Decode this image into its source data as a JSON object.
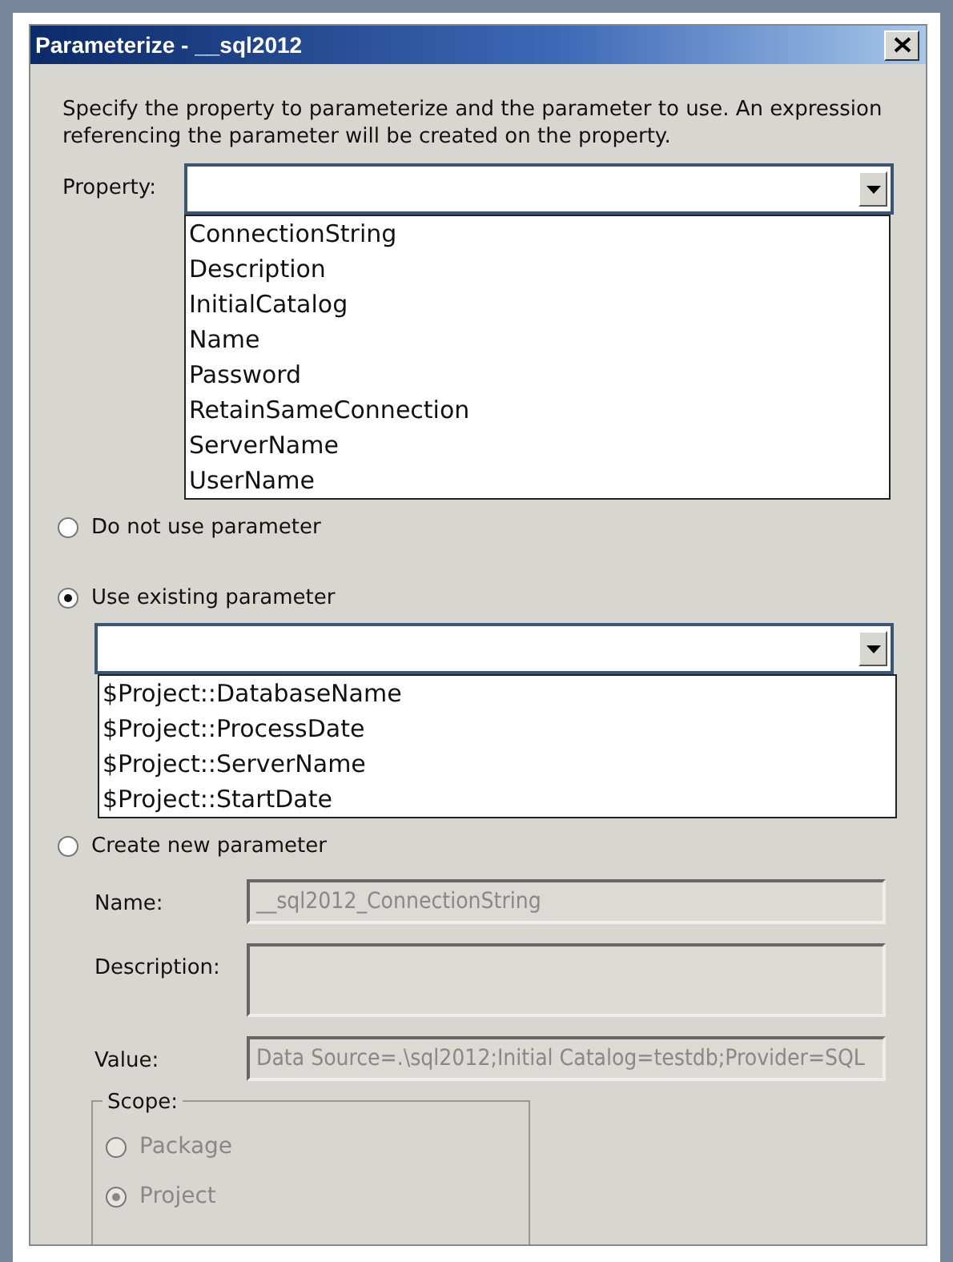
{
  "window": {
    "title": "Parameterize - __sql2012"
  },
  "instructions": "Specify the property to parameterize and the parameter to use. An expression referencing the parameter will be created on the property.",
  "property": {
    "label": "Property:",
    "expanded": true,
    "options": [
      "ConnectionString",
      "Description",
      "InitialCatalog",
      "Name",
      "Password",
      "RetainSameConnection",
      "ServerName",
      "UserName"
    ]
  },
  "modes": [
    {
      "label": "Do not use parameter",
      "selected": false
    },
    {
      "label": "Use existing parameter",
      "selected": true,
      "dropdown": {
        "expanded": true,
        "options": [
          "$Project::DatabaseName",
          "$Project::ProcessDate",
          "$Project::ServerName",
          "$Project::StartDate"
        ]
      }
    },
    {
      "label": "Create new parameter",
      "selected": false
    }
  ],
  "new_parameter": {
    "disabled": true,
    "fields": [
      {
        "label": "Name:",
        "kind": "single",
        "value": "__sql2012_ConnectionString"
      },
      {
        "label": "Description:",
        "kind": "multi"
      },
      {
        "label": "Value:",
        "kind": "single",
        "value": "Data Source=.\\sql2012;Initial Catalog=testdb;Provider=SQL"
      }
    ],
    "scope": {
      "title": "Scope:",
      "options": [
        {
          "label": "Package",
          "selected": false
        },
        {
          "label": "Project",
          "selected": true
        }
      ]
    }
  }
}
